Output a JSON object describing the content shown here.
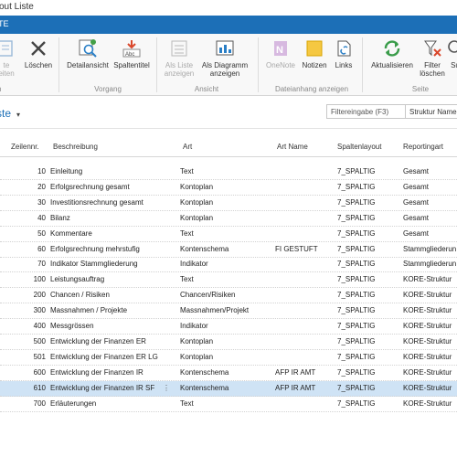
{
  "window": {
    "title": "yout Liste"
  },
  "ribbon_tab": {
    "label": "TE"
  },
  "ribbon": {
    "buttons": [
      {
        "id": "edit",
        "label": "te",
        "label2": "eiten",
        "enabled": false
      },
      {
        "id": "delete",
        "label": "Löschen",
        "label2": "",
        "enabled": true
      },
      {
        "id": "detail",
        "label": "Detailansicht",
        "label2": "",
        "enabled": true
      },
      {
        "id": "columns",
        "label": "Spaltentitel",
        "label2": "",
        "enabled": true
      },
      {
        "id": "aslist",
        "label": "Als Liste",
        "label2": "anzeigen",
        "enabled": false
      },
      {
        "id": "aschart",
        "label": "Als Diagramm",
        "label2": "anzeigen",
        "enabled": true
      },
      {
        "id": "onenote",
        "label": "OneNote",
        "label2": "",
        "enabled": false
      },
      {
        "id": "notes",
        "label": "Notizen",
        "label2": "",
        "enabled": true
      },
      {
        "id": "links",
        "label": "Links",
        "label2": "",
        "enabled": true
      },
      {
        "id": "refresh",
        "label": "Aktualisieren",
        "label2": "",
        "enabled": true
      },
      {
        "id": "clearfilter",
        "label": "Filter",
        "label2": "löschen",
        "enabled": true
      },
      {
        "id": "search",
        "label": "Su",
        "label2": "",
        "enabled": true
      }
    ],
    "groups": {
      "g1": "lten",
      "g2": "Vorgang",
      "g3": "Ansicht",
      "g4": "Dateianhang anzeigen",
      "g5": "Seite"
    }
  },
  "page": {
    "title": "ste",
    "filter_placeholder": "Filtereingabe (F3)",
    "structure_label": "Struktur Name"
  },
  "table": {
    "columns": {
      "nr": "Zeilennr.",
      "desc": "Beschreibung",
      "art": "Art",
      "name": "Art Name",
      "layout": "Spaltenlayout",
      "rep": "Reportingart"
    },
    "rows": [
      {
        "nr": "10",
        "desc": "Einleitung",
        "art": "Text",
        "name": "",
        "layout": "7_SPALTIG",
        "rep": "Gesamt",
        "selected": false
      },
      {
        "nr": "20",
        "desc": "Erfolgsrechnung gesamt",
        "art": "Kontoplan",
        "name": "",
        "layout": "7_SPALTIG",
        "rep": "Gesamt",
        "selected": false
      },
      {
        "nr": "30",
        "desc": "Investitionsrechnung gesamt",
        "art": "Kontoplan",
        "name": "",
        "layout": "7_SPALTIG",
        "rep": "Gesamt",
        "selected": false
      },
      {
        "nr": "40",
        "desc": "Bilanz",
        "art": "Kontoplan",
        "name": "",
        "layout": "7_SPALTIG",
        "rep": "Gesamt",
        "selected": false
      },
      {
        "nr": "50",
        "desc": "Kommentare",
        "art": "Text",
        "name": "",
        "layout": "7_SPALTIG",
        "rep": "Gesamt",
        "selected": false
      },
      {
        "nr": "60",
        "desc": "Erfolgsrechnung mehrstufig",
        "art": "Kontenschema",
        "name": "FI GESTUFT",
        "layout": "7_SPALTIG",
        "rep": "Stammgliederun",
        "selected": false
      },
      {
        "nr": "70",
        "desc": "Indikator Stammgliederung",
        "art": "Indikator",
        "name": "",
        "layout": "7_SPALTIG",
        "rep": "Stammgliederun",
        "selected": false
      },
      {
        "nr": "100",
        "desc": "Leistungsauftrag",
        "art": "Text",
        "name": "",
        "layout": "7_SPALTIG",
        "rep": "KORE-Struktur",
        "selected": false
      },
      {
        "nr": "200",
        "desc": "Chancen / Risiken",
        "art": "Chancen/Risiken",
        "name": "",
        "layout": "7_SPALTIG",
        "rep": "KORE-Struktur",
        "selected": false
      },
      {
        "nr": "300",
        "desc": "Massnahmen / Projekte",
        "art": "Massnahmen/Projekt",
        "name": "",
        "layout": "7_SPALTIG",
        "rep": "KORE-Struktur",
        "selected": false
      },
      {
        "nr": "400",
        "desc": "Messgrössen",
        "art": "Indikator",
        "name": "",
        "layout": "7_SPALTIG",
        "rep": "KORE-Struktur",
        "selected": false
      },
      {
        "nr": "500",
        "desc": "Entwicklung der Finanzen ER",
        "art": "Kontoplan",
        "name": "",
        "layout": "7_SPALTIG",
        "rep": "KORE-Struktur",
        "selected": false
      },
      {
        "nr": "501",
        "desc": "Entwicklung der Finanzen ER LG",
        "art": "Kontoplan",
        "name": "",
        "layout": "7_SPALTIG",
        "rep": "KORE-Struktur",
        "selected": false
      },
      {
        "nr": "600",
        "desc": "Entwicklung der Finanzen IR",
        "art": "Kontenschema",
        "name": "AFP IR AMT",
        "layout": "7_SPALTIG",
        "rep": "KORE-Struktur",
        "selected": false
      },
      {
        "nr": "610",
        "desc": "Entwicklung der Finanzen IR SF",
        "art": "Kontenschema",
        "name": "AFP IR AMT",
        "layout": "7_SPALTIG",
        "rep": "KORE-Struktur",
        "selected": true
      },
      {
        "nr": "700",
        "desc": "Erläuterungen",
        "art": "Text",
        "name": "",
        "layout": "7_SPALTIG",
        "rep": "KORE-Struktur",
        "selected": false
      }
    ],
    "row_menu": "⋮"
  },
  "colors": {
    "accent": "#1c6fb7",
    "selected_row": "#cfe3f5"
  }
}
